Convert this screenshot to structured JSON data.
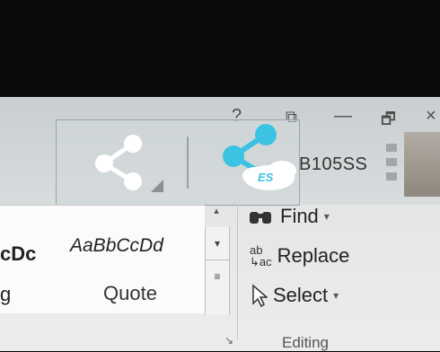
{
  "window_controls": {
    "help": "?",
    "ribbon_display": "⧉",
    "minimize": "—",
    "restore": "🗗",
    "close": "×"
  },
  "share": {
    "left_icon": "share-icon",
    "right_icon": "share-icon-blue",
    "badge": "ES"
  },
  "user": {
    "name": "B105SS"
  },
  "styles": {
    "gallery": [
      {
        "sample": "cDc",
        "name": "g"
      },
      {
        "sample": "AaBbCcDd",
        "name": "Quote"
      }
    ]
  },
  "editing": {
    "find": "Find",
    "replace": "Replace",
    "replace_icon_text": "ab→ac",
    "select": "Select",
    "group_label": "Editing"
  },
  "colors": {
    "share_blue": "#3cc3e3",
    "ribbon_bg": "#e4e6e6"
  }
}
